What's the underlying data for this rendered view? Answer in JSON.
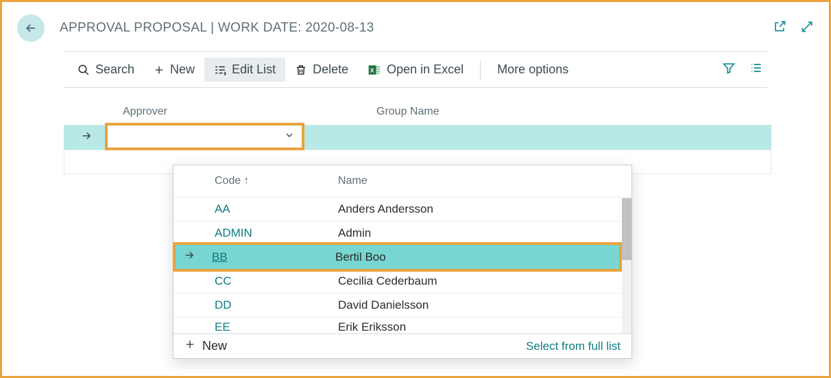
{
  "header": {
    "title": "APPROVAL PROPOSAL | WORK DATE: 2020-08-13"
  },
  "toolbar": {
    "search": "Search",
    "new": "New",
    "edit_list": "Edit List",
    "delete": "Delete",
    "open_excel": "Open in Excel",
    "more_options": "More options"
  },
  "columns": {
    "approver": "Approver",
    "group_name": "Group Name"
  },
  "popup": {
    "col_code": "Code",
    "col_name": "Name",
    "rows": [
      {
        "code": "AA",
        "name": "Anders Andersson"
      },
      {
        "code": "ADMIN",
        "name": "Admin"
      },
      {
        "code": "BB",
        "name": "Bertil Boo"
      },
      {
        "code": "CC",
        "name": "Cecilia Cederbaum"
      },
      {
        "code": "DD",
        "name": "David Danielsson"
      },
      {
        "code": "EE",
        "name": "Erik Eriksson"
      }
    ],
    "footer_new": "New",
    "footer_select": "Select from full list"
  }
}
